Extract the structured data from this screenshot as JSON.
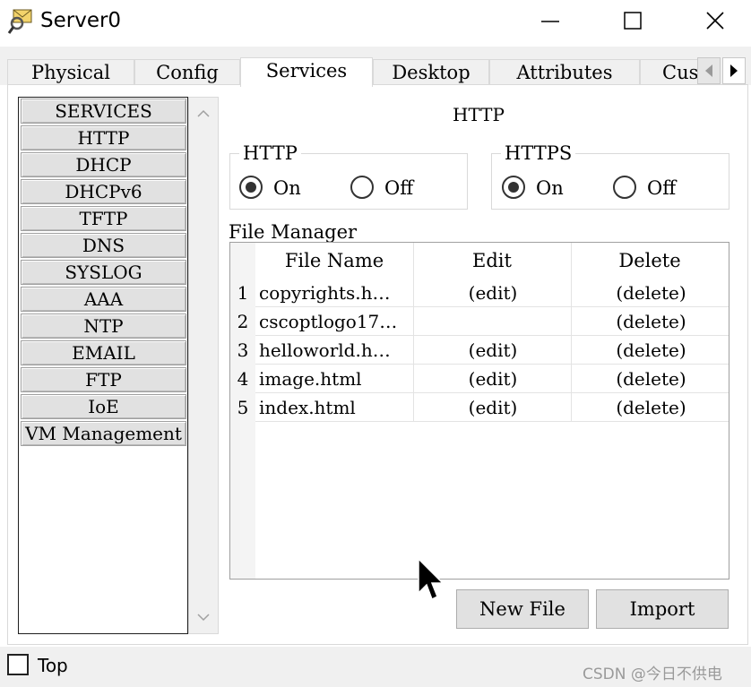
{
  "window": {
    "title": "Server0"
  },
  "tabs": [
    {
      "label": "Physical"
    },
    {
      "label": "Config"
    },
    {
      "label": "Services",
      "active": true
    },
    {
      "label": "Desktop"
    },
    {
      "label": "Attributes"
    },
    {
      "label": "Cus"
    }
  ],
  "services": {
    "items": [
      {
        "label": "SERVICES"
      },
      {
        "label": "HTTP"
      },
      {
        "label": "DHCP"
      },
      {
        "label": "DHCPv6"
      },
      {
        "label": "TFTP"
      },
      {
        "label": "DNS"
      },
      {
        "label": "SYSLOG"
      },
      {
        "label": "AAA"
      },
      {
        "label": "NTP"
      },
      {
        "label": "EMAIL"
      },
      {
        "label": "FTP"
      },
      {
        "label": "IoE"
      },
      {
        "label": "VM Management"
      }
    ]
  },
  "main": {
    "heading": "HTTP",
    "http": {
      "legend": "HTTP",
      "on_label": "On",
      "off_label": "Off",
      "selected": "on"
    },
    "https": {
      "legend": "HTTPS",
      "on_label": "On",
      "off_label": "Off",
      "selected": "on"
    },
    "file_manager": {
      "label": "File Manager",
      "columns": [
        "File Name",
        "Edit",
        "Delete"
      ],
      "rows": [
        {
          "num": "1",
          "name": "copyrights.h…",
          "edit": "(edit)",
          "delete": "(delete)"
        },
        {
          "num": "2",
          "name": "cscoptlogo17…",
          "edit": "",
          "delete": "(delete)"
        },
        {
          "num": "3",
          "name": "helloworld.h…",
          "edit": "(edit)",
          "delete": "(delete)"
        },
        {
          "num": "4",
          "name": "image.html",
          "edit": "(edit)",
          "delete": "(delete)"
        },
        {
          "num": "5",
          "name": "index.html",
          "edit": "(edit)",
          "delete": "(delete)"
        }
      ]
    },
    "buttons": {
      "new_file": "New File",
      "import": "Import"
    }
  },
  "bottom": {
    "top_label": "Top",
    "top_checked": false
  },
  "watermark": "CSDN @今日不供电",
  "icons": {
    "app": "magnifier-envelope-icon",
    "minimize": "minimize-icon",
    "maximize": "maximize-icon",
    "close": "close-icon",
    "tab_left": "chevron-left-icon",
    "tab_right": "chevron-right-icon",
    "cursor": "mouse-pointer-icon"
  }
}
